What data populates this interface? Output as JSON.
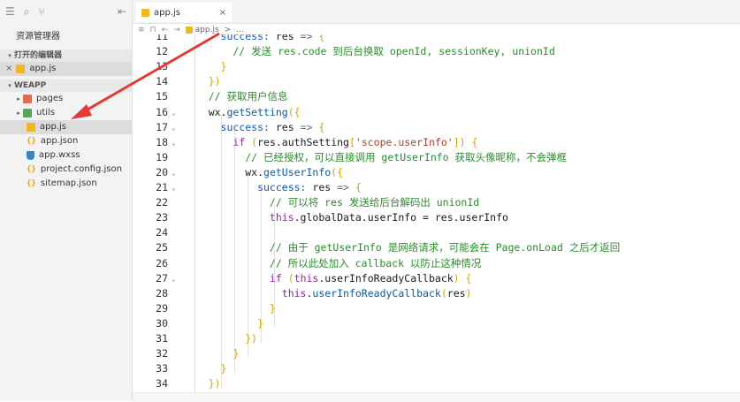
{
  "sidebar": {
    "title": "资源管理器",
    "open_editors_label": "打开的编辑器",
    "open_file": "app.js",
    "project_label": "WEAPP",
    "files": [
      {
        "label": "pages",
        "icon": "folder-red",
        "twisty": "▸",
        "indent": 1
      },
      {
        "label": "utils",
        "icon": "folder-green",
        "twisty": "▸",
        "indent": 1
      },
      {
        "label": "app.js",
        "icon": "js",
        "twisty": "",
        "indent": 2,
        "selected": true
      },
      {
        "label": "app.json",
        "icon": "brace",
        "twisty": "",
        "indent": 2
      },
      {
        "label": "app.wxss",
        "icon": "css",
        "twisty": "",
        "indent": 2
      },
      {
        "label": "project.config.json",
        "icon": "brace",
        "twisty": "",
        "indent": 2
      },
      {
        "label": "sitemap.json",
        "icon": "brace",
        "twisty": "",
        "indent": 2
      }
    ]
  },
  "tab": {
    "label": "app.js",
    "close": "×"
  },
  "breadcrumb": {
    "file": "app.js",
    "sep": ">",
    "rest": "..."
  },
  "colors": {
    "keyword": "#0d57b8",
    "function": "#0a5a9c",
    "string": "#b53a2a",
    "comment": "#2c8a2d",
    "bracket": "#d3a400"
  },
  "code": [
    {
      "n": "11",
      "fold": "",
      "indent": 0,
      "tokens": [
        [
          "key",
          "      success: "
        ],
        [
          "var",
          "res "
        ],
        [
          "pn",
          "=> "
        ],
        [
          "br",
          "{"
        ]
      ]
    },
    {
      "n": "12",
      "fold": "",
      "indent": 0,
      "tokens": [
        [
          "cm",
          "        // 发送 res.code 到后台换取 openId, sessionKey, unionId"
        ]
      ]
    },
    {
      "n": "13",
      "fold": "",
      "indent": 0,
      "tokens": [
        [
          "br",
          "      }"
        ]
      ]
    },
    {
      "n": "14",
      "fold": "",
      "indent": 0,
      "tokens": [
        [
          "br",
          "    })"
        ]
      ]
    },
    {
      "n": "15",
      "fold": "",
      "indent": 0,
      "tokens": [
        [
          "cm",
          "    // 获取用户信息"
        ]
      ]
    },
    {
      "n": "16",
      "fold": "⌄",
      "indent": 0,
      "tokens": [
        [
          "var",
          "    wx."
        ],
        [
          "fn",
          "getSetting"
        ],
        [
          "br",
          "({"
        ]
      ]
    },
    {
      "n": "17",
      "fold": "⌄",
      "indent": 0,
      "tokens": [
        [
          "key",
          "      success: "
        ],
        [
          "var",
          "res "
        ],
        [
          "pn",
          "=> "
        ],
        [
          "br",
          "{"
        ]
      ]
    },
    {
      "n": "18",
      "fold": "⌄",
      "indent": 0,
      "tokens": [
        [
          "kw",
          "        if "
        ],
        [
          "br",
          "("
        ],
        [
          "var",
          "res.authSetting"
        ],
        [
          "br",
          "["
        ],
        [
          "str",
          "'scope.userInfo'"
        ],
        [
          "br",
          "]) {"
        ]
      ]
    },
    {
      "n": "19",
      "fold": "",
      "indent": 0,
      "tokens": [
        [
          "cm",
          "          // 已经授权，可以直接调用 getUserInfo 获取头像昵称，不会弹框"
        ]
      ]
    },
    {
      "n": "20",
      "fold": "⌄",
      "indent": 0,
      "tokens": [
        [
          "var",
          "          wx."
        ],
        [
          "fn",
          "getUserInfo"
        ],
        [
          "br",
          "({"
        ]
      ]
    },
    {
      "n": "21",
      "fold": "⌄",
      "indent": 0,
      "tokens": [
        [
          "key",
          "            success: "
        ],
        [
          "var",
          "res "
        ],
        [
          "pn",
          "=> "
        ],
        [
          "br",
          "{"
        ]
      ]
    },
    {
      "n": "22",
      "fold": "",
      "indent": 0,
      "tokens": [
        [
          "cm",
          "              // 可以将 res 发送给后台解码出 unionId"
        ]
      ]
    },
    {
      "n": "23",
      "fold": "",
      "indent": 0,
      "tokens": [
        [
          "kw",
          "              this"
        ],
        [
          "var",
          ".globalData.userInfo = res.userInfo"
        ]
      ]
    },
    {
      "n": "24",
      "fold": "",
      "indent": 0,
      "tokens": []
    },
    {
      "n": "25",
      "fold": "",
      "indent": 0,
      "tokens": [
        [
          "cm",
          "              // 由于 getUserInfo 是网络请求，可能会在 Page.onLoad 之后才返回"
        ]
      ]
    },
    {
      "n": "26",
      "fold": "",
      "indent": 0,
      "tokens": [
        [
          "cm",
          "              // 所以此处加入 callback 以防止这种情况"
        ]
      ]
    },
    {
      "n": "27",
      "fold": "⌄",
      "indent": 0,
      "tokens": [
        [
          "kw",
          "              if "
        ],
        [
          "br",
          "("
        ],
        [
          "kw",
          "this"
        ],
        [
          "var",
          ".userInfoReadyCallback"
        ],
        [
          "br",
          ") {"
        ]
      ]
    },
    {
      "n": "28",
      "fold": "",
      "indent": 0,
      "tokens": [
        [
          "kw",
          "                this"
        ],
        [
          "var",
          "."
        ],
        [
          "fn",
          "userInfoReadyCallback"
        ],
        [
          "br",
          "("
        ],
        [
          "var",
          "res"
        ],
        [
          "br",
          ")"
        ]
      ]
    },
    {
      "n": "29",
      "fold": "",
      "indent": 0,
      "tokens": [
        [
          "br",
          "              }"
        ]
      ]
    },
    {
      "n": "30",
      "fold": "",
      "indent": 0,
      "tokens": [
        [
          "br",
          "            }"
        ]
      ]
    },
    {
      "n": "31",
      "fold": "",
      "indent": 0,
      "tokens": [
        [
          "br",
          "          })"
        ]
      ]
    },
    {
      "n": "32",
      "fold": "",
      "indent": 0,
      "tokens": [
        [
          "br",
          "        }"
        ]
      ]
    },
    {
      "n": "33",
      "fold": "",
      "indent": 0,
      "tokens": [
        [
          "br",
          "      }"
        ]
      ]
    },
    {
      "n": "34",
      "fold": "",
      "indent": 0,
      "tokens": [
        [
          "br",
          "    })"
        ]
      ]
    }
  ]
}
